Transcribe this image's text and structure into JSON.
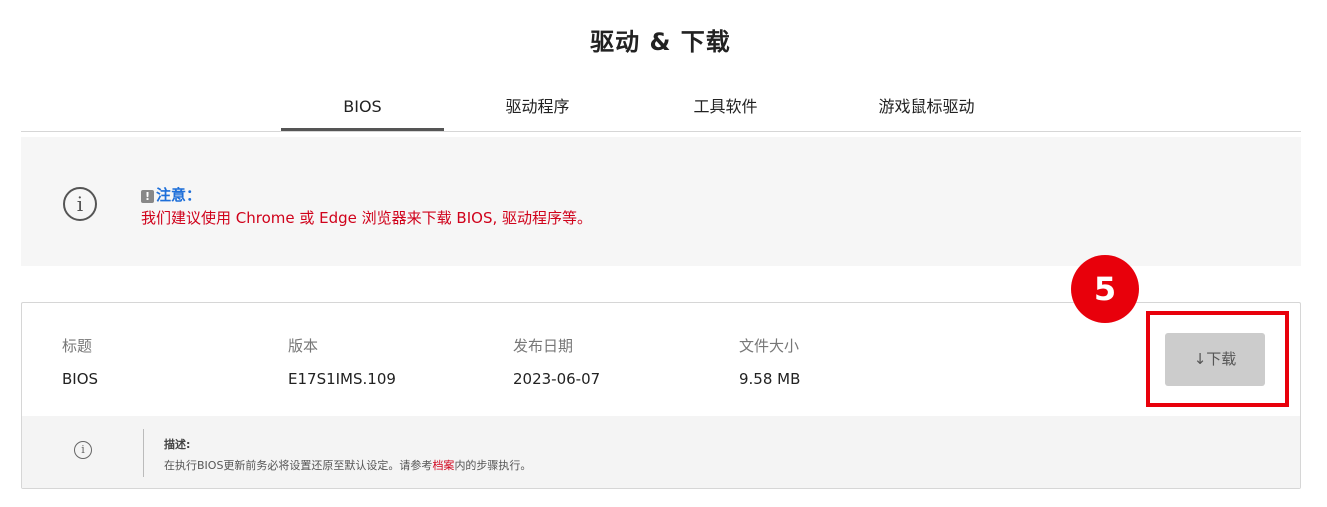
{
  "page": {
    "title": "驱动 & 下载"
  },
  "tabs": [
    {
      "label": "BIOS",
      "active": true
    },
    {
      "label": "驱动程序",
      "active": false
    },
    {
      "label": "工具软件",
      "active": false
    },
    {
      "label": "游戏鼠标驱动",
      "active": false
    }
  ],
  "notice": {
    "icon": "info-circle-icon",
    "badge_icon": "exclamation-icon",
    "badge_glyph": "!",
    "title": "注意：",
    "message": "我们建议使用 Chrome 或 Edge 浏览器来下载 BIOS, 驱动程序等。"
  },
  "download_item": {
    "headers": {
      "title": "标题",
      "version": "版本",
      "date": "发布日期",
      "size": "文件大小"
    },
    "values": {
      "title": "BIOS",
      "version": "E17S1IMS.109",
      "date": "2023-06-07",
      "size": "9.58 MB"
    },
    "download_label": "↓下载",
    "description": {
      "label": "描述:",
      "text_before": "在执行BIOS更新前务必将设置还原至默认设定。请参考",
      "link": "档案",
      "text_after": "内的步骤执行。"
    }
  },
  "annotation": {
    "step_number": "5",
    "color": "#e8000b"
  },
  "colors": {
    "accent_blue": "#1e6fd9",
    "warning_red": "#d0021b"
  }
}
